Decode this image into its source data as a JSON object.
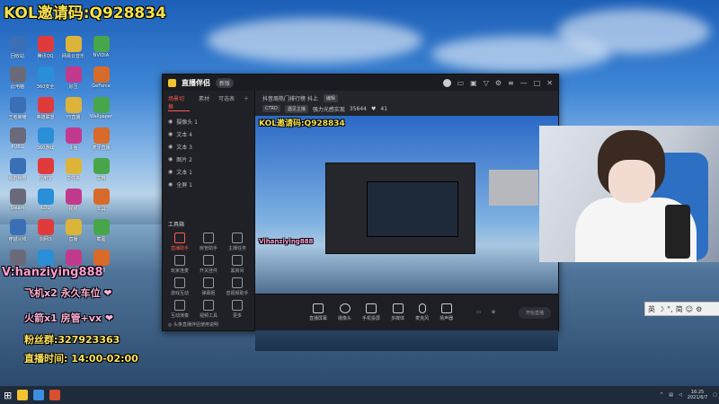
{
  "overlay": {
    "top_text": "KOL邀请码:Q928834",
    "vx_line": "V:hanziying888",
    "line1": "飞机x2 永久车位 ❤",
    "line2": "火箭x1 房管+vx ❤",
    "line3": "粉丝群:327923363",
    "line4": "直播时间: 14:00-02:00",
    "preview_top_text": "KOL邀请码:Q928834",
    "preview_vx": "Vihanziying888"
  },
  "app": {
    "brand": "直播伴侣",
    "badge": "新版",
    "tabs": [
      "场景切换",
      "素材",
      "可选表"
    ],
    "sources": [
      "摄像头 1",
      "文本 4",
      "文本 3",
      "图片 2",
      "文本 1",
      "全屏 1"
    ],
    "tools_title": "工具箱",
    "tools": [
      "直播助手",
      "房管助手",
      "主播任务",
      "玩家连麦",
      "开关挂件",
      "黑房间",
      "游戏互动",
      "弹幕姬",
      "音视频助手",
      "互动演奏",
      "视频工具",
      "更多"
    ],
    "bottom_note": "◎ 头条直播伴侣使用说明",
    "info": {
      "title": "抖音周热门排行榜 抖上",
      "edit": "编辑",
      "tag1": "CTRD",
      "tag2": "遇见主播",
      "tag3": "强力光感实现",
      "count": "35644",
      "likes": "41"
    },
    "controls": [
      "直播屏幕",
      "摄像头",
      "手机投屏",
      "多媒体",
      "麦克风",
      "扬声器"
    ],
    "start_button": "开始直播",
    "status": [
      "CPU: 00%",
      "内存: 00%",
      "CPU:00%",
      "帧率: 00%",
      "码率: 00%"
    ]
  },
  "ime": {
    "items": [
      "英",
      "☽",
      "°,",
      "简",
      "☺",
      "⚙"
    ]
  },
  "taskbar": {
    "time": "16:25",
    "date": "2021/6/7"
  },
  "desktop": {
    "icons": [
      "回收站",
      "腾讯QQ",
      "网易云音乐",
      "NVIDIA",
      "此电脑",
      "360安全",
      "好压",
      "GeForce",
      "王者荣耀",
      "英雄联盟",
      "YY直播",
      "Wallpaper",
      "PUBG",
      "360游戏",
      "斗鱼",
      "虎牙直播",
      "我的世界",
      "应用宝",
      "文件夹",
      "文档",
      "Steam",
      "LOL",
      "视频",
      "工具",
      "穿越火线",
      "剑网3",
      "直播",
      "截图",
      "QQ",
      "微信",
      "浏览器",
      "抖音"
    ],
    "colors": [
      "#3a6fb5",
      "#e03b3b",
      "#ddb43a",
      "#47a64a",
      "#6a6a7a",
      "#2a8fd6",
      "#c23a8e",
      "#d86a2a"
    ]
  }
}
